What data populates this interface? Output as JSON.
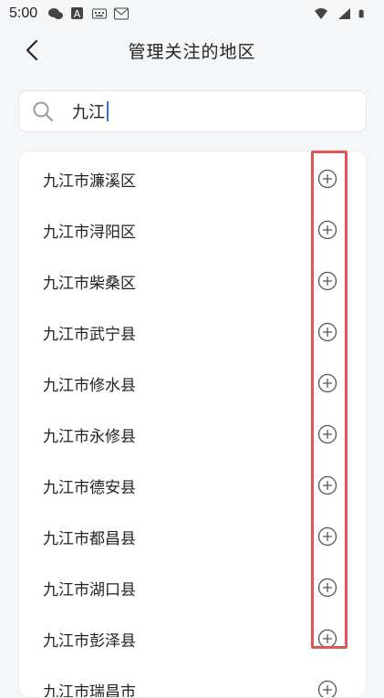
{
  "status_bar": {
    "time": "5:00"
  },
  "header": {
    "title": "管理关注的地区"
  },
  "search": {
    "value": "九江"
  },
  "regions": [
    {
      "label": "九江市濂溪区"
    },
    {
      "label": "九江市浔阳区"
    },
    {
      "label": "九江市柴桑区"
    },
    {
      "label": "九江市武宁县"
    },
    {
      "label": "九江市修水县"
    },
    {
      "label": "九江市永修县"
    },
    {
      "label": "九江市德安县"
    },
    {
      "label": "九江市都昌县"
    },
    {
      "label": "九江市湖口县"
    },
    {
      "label": "九江市彭泽县"
    },
    {
      "label": "九江市瑞昌市"
    }
  ],
  "colors": {
    "highlight": "#e05555",
    "caret": "#2f6fd8"
  }
}
